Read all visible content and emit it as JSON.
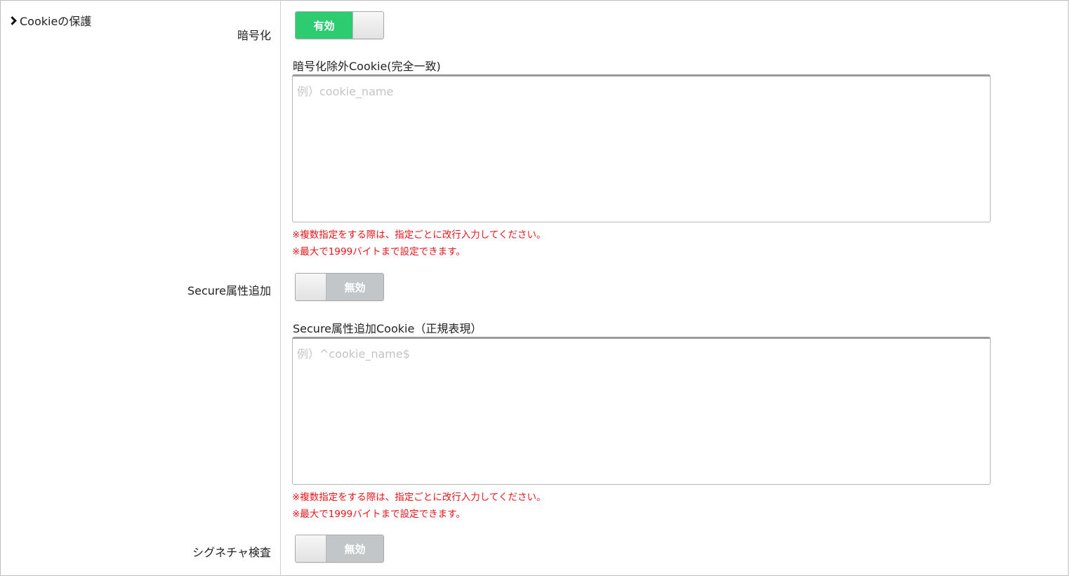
{
  "section": {
    "title": "Cookieの保護"
  },
  "encryption": {
    "label": "暗号化",
    "toggle_text": "有効",
    "state": "on",
    "exclude_label": "暗号化除外Cookie(完全一致)",
    "exclude_placeholder": "例）cookie_name",
    "note_multiple": "※複数指定をする際は、指定ごとに改行入力してください。",
    "note_max": "※最大で1999バイトまで設定できます。"
  },
  "secure": {
    "label": "Secure属性追加",
    "toggle_text": "無効",
    "state": "off",
    "cookie_label": "Secure属性追加Cookie（正規表現）",
    "cookie_placeholder": "例）^cookie_name$",
    "note_multiple": "※複数指定をする際は、指定ごとに改行入力してください。",
    "note_max": "※最大で1999バイトまで設定できます。"
  },
  "signature": {
    "label": "シグネチャ検査",
    "toggle_text": "無効",
    "state": "off"
  },
  "colors": {
    "toggle_on": "#2ecc71",
    "toggle_off": "#c3c6c9",
    "note_red": "#e8141a"
  }
}
